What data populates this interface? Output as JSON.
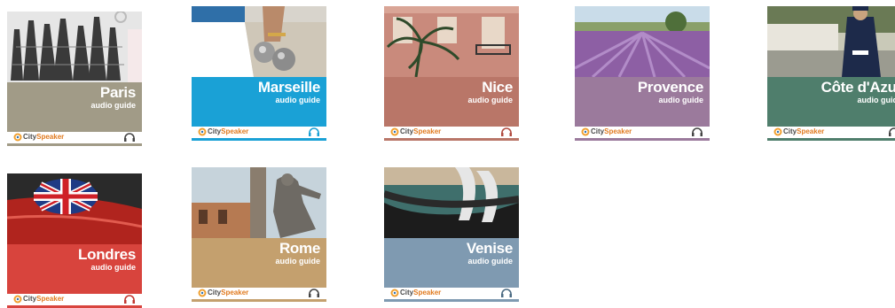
{
  "brand": {
    "part1": "City",
    "part2": "Speaker"
  },
  "cards": [
    {
      "city": "Paris",
      "subtitle": "audio guide",
      "band_color": "#a19b87",
      "icon": "eiffel-tower-keychains-photo"
    },
    {
      "city": "Marseille",
      "subtitle": "audio guide",
      "band_color": "#1aa1d6",
      "icon": "petanque-balls-photo"
    },
    {
      "city": "Nice",
      "subtitle": "audio guide",
      "band_color": "#b97668",
      "icon": "palm-facade-photo"
    },
    {
      "city": "Provence",
      "subtitle": "audio guide",
      "band_color": "#9b7a9c",
      "icon": "lavender-field-photo"
    },
    {
      "city": "Côte d'Azur",
      "subtitle": "audio guide",
      "band_color": "#4f7e6c",
      "icon": "doorman-photo"
    },
    {
      "city": "Londres",
      "subtitle": "audio guide",
      "band_color": "#d8443d",
      "icon": "union-jack-mirror-photo"
    },
    {
      "city": "Rome",
      "subtitle": "audio guide",
      "band_color": "#c4a06e",
      "icon": "roman-statue-photo"
    },
    {
      "city": "Venise",
      "subtitle": "audio guide",
      "band_color": "#7f9ab1",
      "icon": "gondolas-photo"
    }
  ]
}
